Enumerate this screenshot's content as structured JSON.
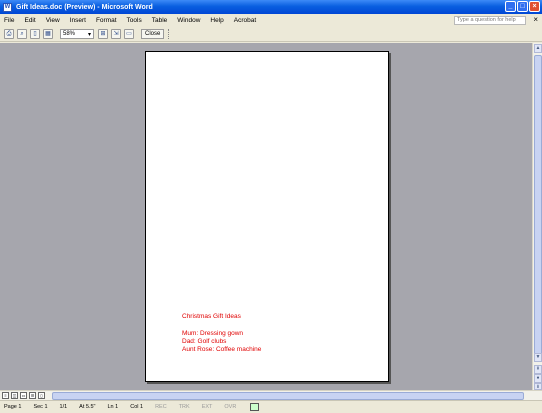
{
  "window": {
    "title": "Gift Ideas.doc (Preview) - Microsoft Word",
    "controls": {
      "minimize": "_",
      "maximize": "□",
      "close": "×"
    }
  },
  "menubar": {
    "items": [
      "File",
      "Edit",
      "View",
      "Insert",
      "Format",
      "Tools",
      "Table",
      "Window",
      "Help",
      "Acrobat"
    ],
    "help_placeholder": "Type a question for help",
    "doc_close": "×"
  },
  "toolbar": {
    "zoom": "58%",
    "close_label": "Close"
  },
  "document": {
    "lines": [
      "Christmas Gift Ideas",
      "Mum: Dressing gown",
      "Dad: Golf clubs",
      "Aunt Rose: Coffee machine"
    ]
  },
  "statusbar": {
    "items": [
      "Page 1",
      "Sec 1",
      "1/1",
      "At 5.5\"",
      "Ln 1",
      "Col 1",
      "REC",
      "TRK",
      "EXT",
      "OVR"
    ]
  },
  "colors": {
    "title_bar": "#0a5fe0",
    "document_text": "#e00000",
    "workspace": "#a6a6ad"
  }
}
